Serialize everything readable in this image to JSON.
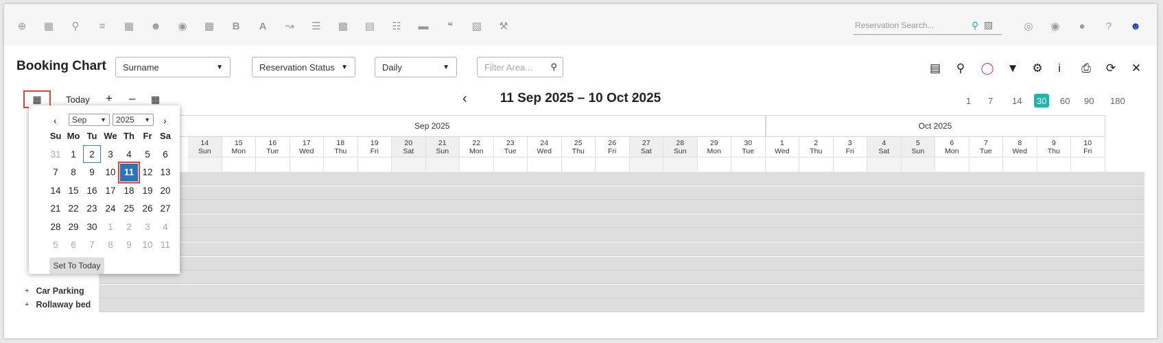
{
  "topbar": {
    "icons": [
      "plus-circle-icon",
      "calendar-icon",
      "search-icon",
      "sliders-icon",
      "grid-icon",
      "users-icon",
      "map-marker-icon",
      "map-icon",
      "bold-b-icon",
      "font-a-icon",
      "line-chart-icon",
      "checklist-icon",
      "money-icon",
      "document-icon",
      "cart-icon",
      "tag-money-icon",
      "quote-icon",
      "bed-icon",
      "hammer-icon"
    ],
    "search_placeholder": "Reservation Search...",
    "right_icons": [
      "globe-icon",
      "bell-icon",
      "chat-icon",
      "help-icon",
      "user-icon"
    ]
  },
  "toolbar": {
    "title": "Booking Chart",
    "selects": [
      {
        "value": "Surname"
      },
      {
        "value": "Reservation Status"
      },
      {
        "value": "Daily"
      }
    ],
    "filter_placeholder": "Filter Area...",
    "right_icons": [
      "list-icon",
      "pin-icon",
      "comment-icon",
      "filter-icon",
      "gear-icon",
      "info-icon",
      "print-icon",
      "refresh-icon",
      "close-icon"
    ]
  },
  "chart": {
    "today_label": "Today",
    "plus_label": "+",
    "minus_label": "–",
    "range": "11 Sep 2025 – 10 Oct 2025",
    "zoom_options": [
      "1",
      "7",
      "14",
      "30",
      "60",
      "90",
      "180"
    ],
    "zoom_active": "30",
    "months": [
      "Sep 2025",
      "Oct 2025"
    ],
    "days": [
      {
        "d": "14",
        "w": "Sun"
      },
      {
        "d": "15",
        "w": "Mon"
      },
      {
        "d": "16",
        "w": "Tue"
      },
      {
        "d": "17",
        "w": "Wed"
      },
      {
        "d": "18",
        "w": "Thu"
      },
      {
        "d": "19",
        "w": "Fri"
      },
      {
        "d": "20",
        "w": "Sat"
      },
      {
        "d": "21",
        "w": "Sun"
      },
      {
        "d": "22",
        "w": "Mon"
      },
      {
        "d": "23",
        "w": "Tue"
      },
      {
        "d": "24",
        "w": "Wed"
      },
      {
        "d": "25",
        "w": "Thu"
      },
      {
        "d": "26",
        "w": "Fri"
      },
      {
        "d": "27",
        "w": "Sat"
      },
      {
        "d": "28",
        "w": "Sun"
      },
      {
        "d": "29",
        "w": "Mon"
      },
      {
        "d": "30",
        "w": "Tue"
      },
      {
        "d": "1",
        "w": "Wed"
      },
      {
        "d": "2",
        "w": "Thu"
      },
      {
        "d": "3",
        "w": "Fri"
      },
      {
        "d": "4",
        "w": "Sat"
      },
      {
        "d": "5",
        "w": "Sun"
      },
      {
        "d": "6",
        "w": "Mon"
      },
      {
        "d": "7",
        "w": "Tue"
      },
      {
        "d": "8",
        "w": "Wed"
      },
      {
        "d": "9",
        "w": "Thu"
      },
      {
        "d": "10",
        "w": "Fri"
      }
    ],
    "rows": [
      {
        "label": "",
        "plus": ""
      },
      {
        "label": "",
        "plus": ""
      },
      {
        "label": "",
        "plus": ""
      },
      {
        "label": "",
        "plus": ""
      },
      {
        "label": "",
        "plus": ""
      },
      {
        "label": "",
        "plus": ""
      },
      {
        "label": "",
        "plus": ""
      },
      {
        "label": "",
        "plus": ""
      },
      {
        "label": "Car Parking",
        "plus": "+"
      },
      {
        "label": "Rollaway bed",
        "plus": "+"
      }
    ]
  },
  "datepicker": {
    "month": "Sep",
    "year": "2025",
    "weekdays": [
      "Su",
      "Mo",
      "Tu",
      "We",
      "Th",
      "Fr",
      "Sa"
    ],
    "weeks": [
      [
        {
          "n": "31",
          "m": true
        },
        {
          "n": "1"
        },
        {
          "n": "2",
          "t": true
        },
        {
          "n": "3"
        },
        {
          "n": "4"
        },
        {
          "n": "5"
        },
        {
          "n": "6"
        }
      ],
      [
        {
          "n": "7"
        },
        {
          "n": "8"
        },
        {
          "n": "9"
        },
        {
          "n": "10"
        },
        {
          "n": "11",
          "s": true
        },
        {
          "n": "12"
        },
        {
          "n": "13"
        }
      ],
      [
        {
          "n": "14"
        },
        {
          "n": "15"
        },
        {
          "n": "16"
        },
        {
          "n": "17"
        },
        {
          "n": "18"
        },
        {
          "n": "19"
        },
        {
          "n": "20"
        }
      ],
      [
        {
          "n": "21"
        },
        {
          "n": "22"
        },
        {
          "n": "23"
        },
        {
          "n": "24"
        },
        {
          "n": "25"
        },
        {
          "n": "26"
        },
        {
          "n": "27"
        }
      ],
      [
        {
          "n": "28"
        },
        {
          "n": "29"
        },
        {
          "n": "30"
        },
        {
          "n": "1",
          "m": true
        },
        {
          "n": "2",
          "m": true
        },
        {
          "n": "3",
          "m": true
        },
        {
          "n": "4",
          "m": true
        }
      ],
      [
        {
          "n": "5",
          "m": true
        },
        {
          "n": "6",
          "m": true
        },
        {
          "n": "7",
          "m": true
        },
        {
          "n": "8",
          "m": true
        },
        {
          "n": "9",
          "m": true
        },
        {
          "n": "10",
          "m": true
        },
        {
          "n": "11",
          "m": true
        }
      ]
    ],
    "set_today_label": "Set To Today"
  },
  "colors": {
    "accent": "#1db6ad",
    "selected": "#2a74b7",
    "highlight": "#e0443c",
    "comment": "#e5307a",
    "user": "#1b3fbf"
  }
}
